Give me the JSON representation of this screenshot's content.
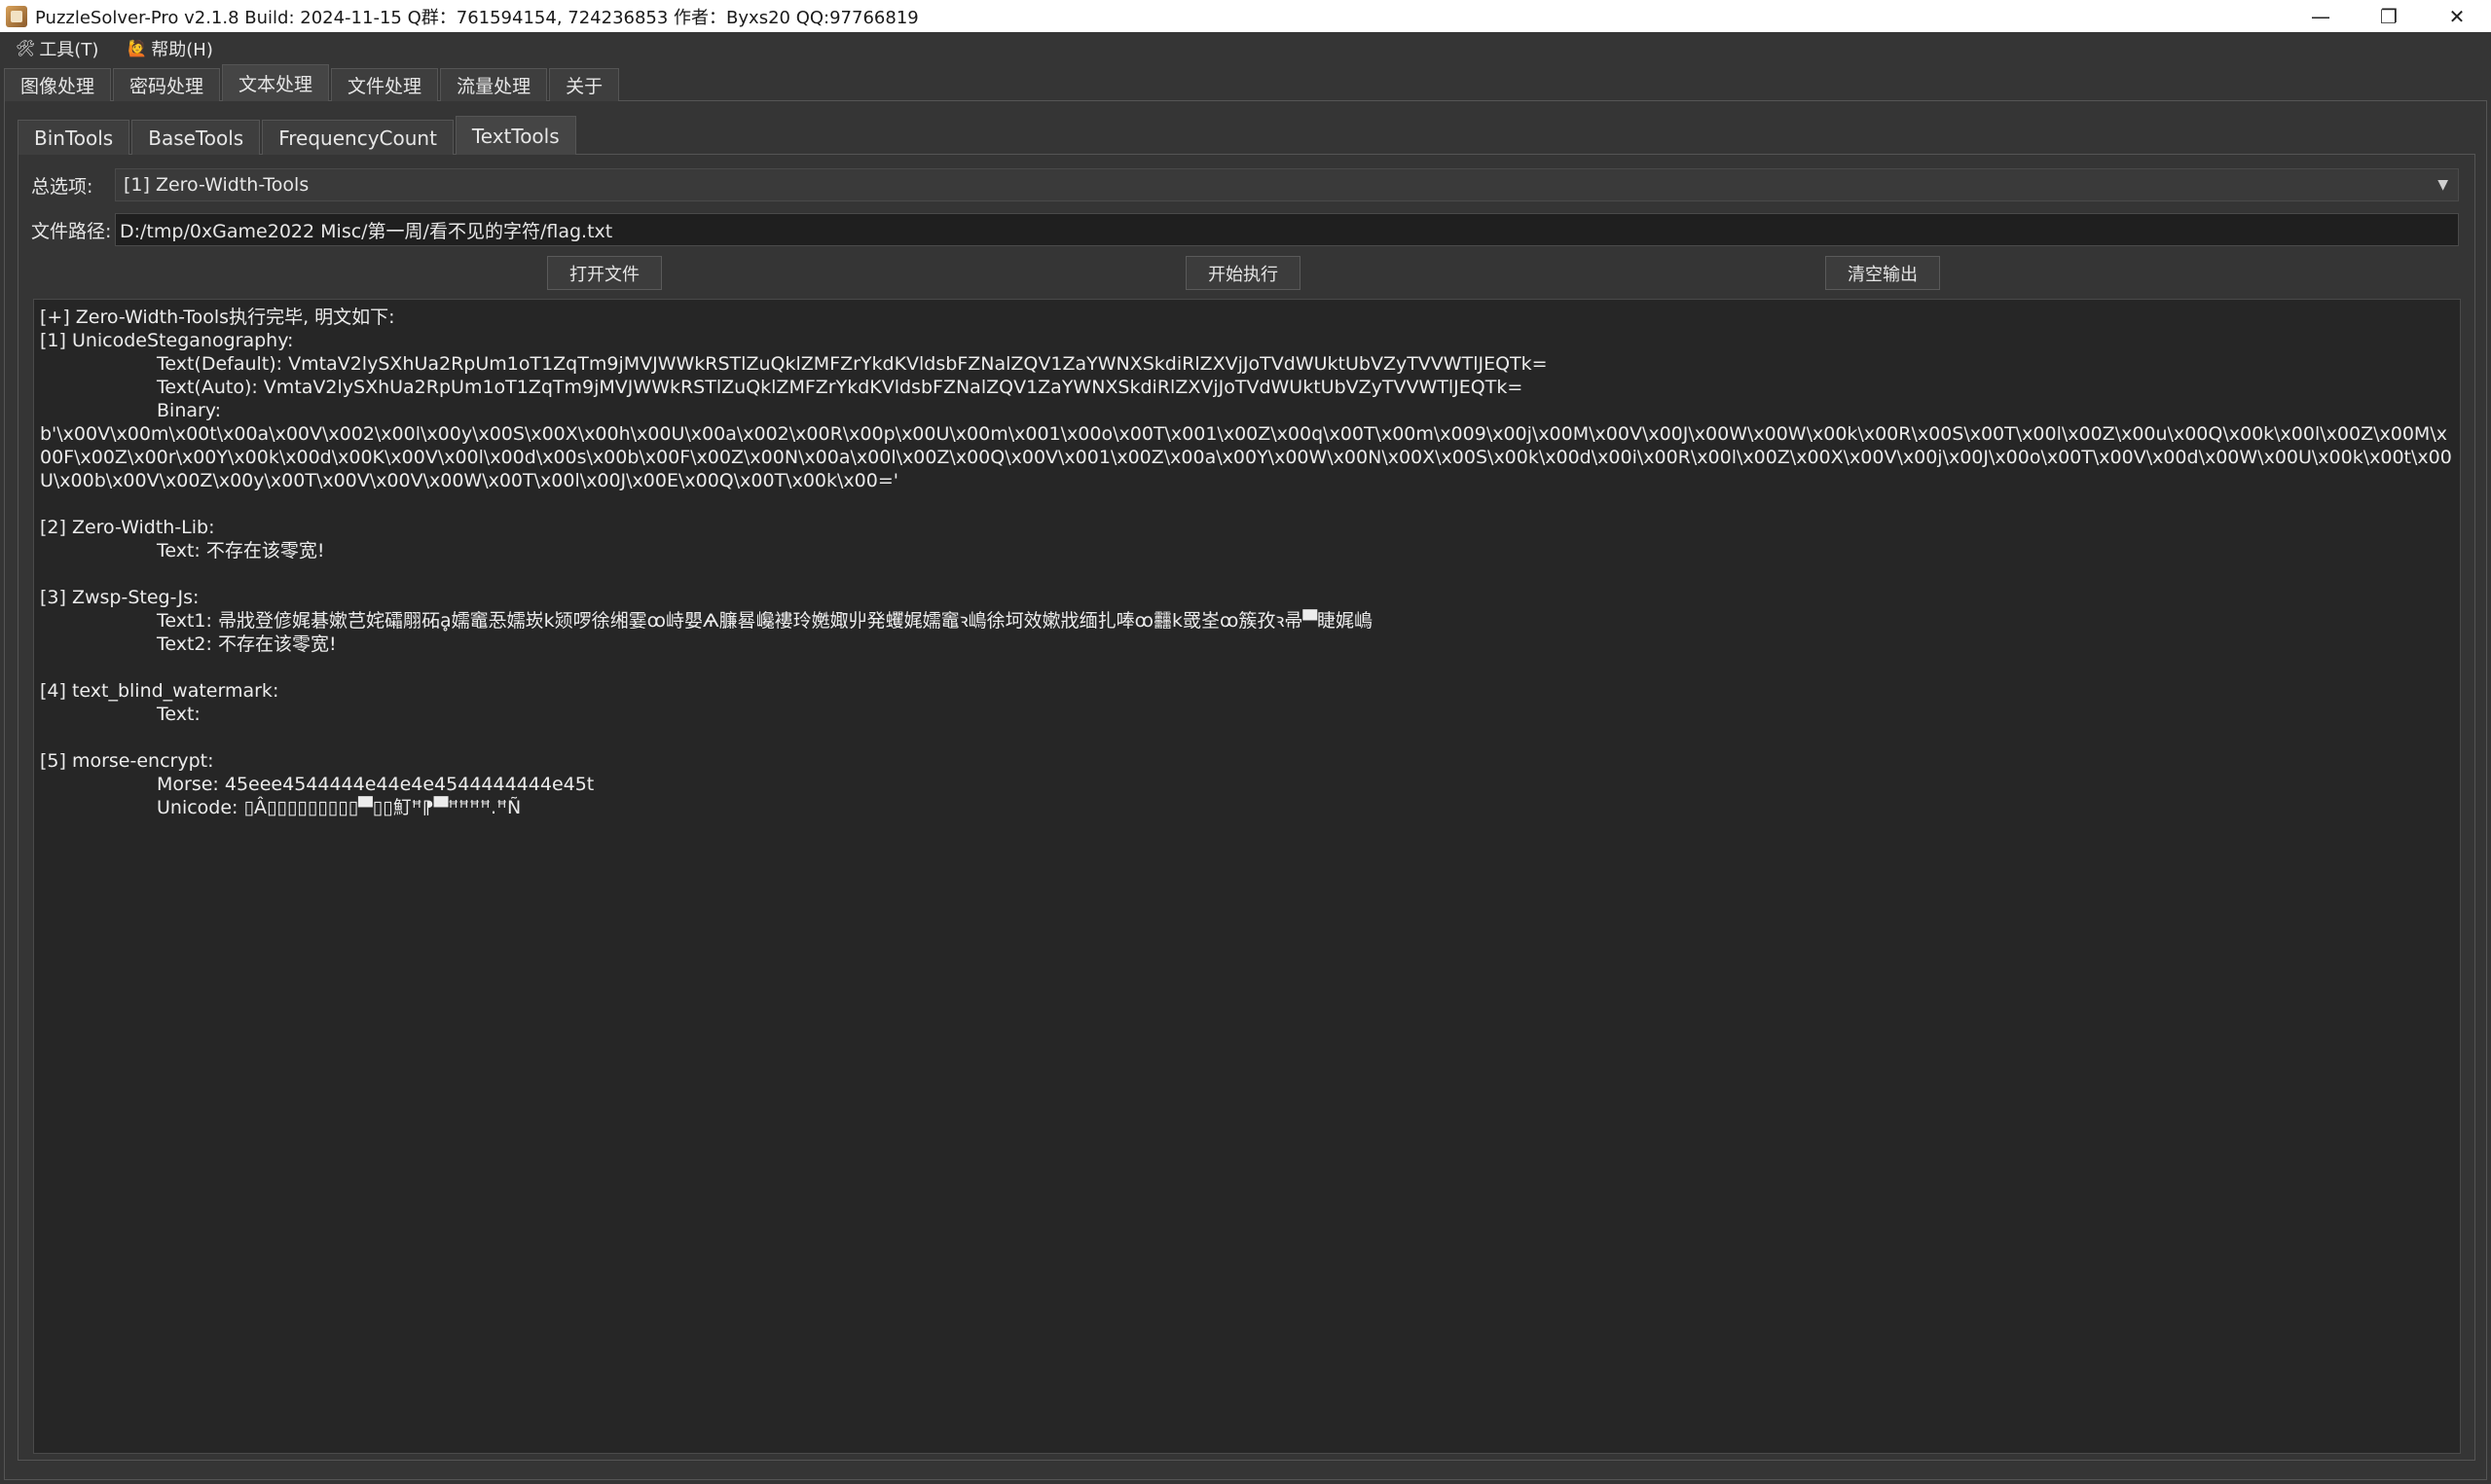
{
  "window": {
    "title": "PuzzleSolver-Pro v2.1.8  Build: 2024-11-15  Q群：761594154, 724236853  作者：Byxs20  QQ:97766819",
    "minimize": "—",
    "restore": "❐",
    "close": "✕"
  },
  "menu": [
    {
      "label": "工具(T)",
      "icon": "🛠"
    },
    {
      "label": "帮助(H)",
      "icon": "🙋"
    }
  ],
  "top_tabs": [
    "图像处理",
    "密码处理",
    "文本处理",
    "文件处理",
    "流量处理",
    "关于"
  ],
  "sub_tabs": [
    "BinTools",
    "BaseTools",
    "FrequencyCount",
    "TextTools"
  ],
  "options": {
    "label": "总选项:",
    "selected": "[1] Zero-Width-Tools"
  },
  "file": {
    "label": "文件路径:",
    "path": "D:/tmp/0xGame2022 Misc/第一周/看不见的字符/flag.txt"
  },
  "buttons": {
    "open": "打开文件",
    "run": "开始执行",
    "clear": "清空输出"
  },
  "output": {
    "l1": "[+] Zero-Width-Tools执行完毕, 明文如下:",
    "l2": "[1] UnicodeSteganography:",
    "l3": "Text(Default): VmtaV2lySXhUa2RpUm1oT1ZqTm9jMVJWWkRSTlZuQklZMFZrYkdKVldsbFZNalZQV1ZaYWNXSkdiRlZXVjJoTVdWUktUbVZyTVVWTlJEQTk=",
    "l4": "Text(Auto): VmtaV2lySXhUa2RpUm1oT1ZqTm9jMVJWWkRSTlZuQklZMFZrYkdKVldsbFZNalZQV1ZaYWNXSkdiRlZXVjJoTVdWUktUbVZyTVVWTlJEQTk=",
    "l5": "Binary:",
    "l6": "b'\\x00V\\x00m\\x00t\\x00a\\x00V\\x002\\x00l\\x00y\\x00S\\x00X\\x00h\\x00U\\x00a\\x002\\x00R\\x00p\\x00U\\x00m\\x001\\x00o\\x00T\\x001\\x00Z\\x00q\\x00T\\x00m\\x009\\x00j\\x00M\\x00V\\x00J\\x00W\\x00W\\x00k\\x00R\\x00S\\x00T\\x00l\\x00Z\\x00u\\x00Q\\x00k\\x00l\\x00Z\\x00M\\x00F\\x00Z\\x00r\\x00Y\\x00k\\x00d\\x00K\\x00V\\x00l\\x00d\\x00s\\x00b\\x00F\\x00Z\\x00N\\x00a\\x00l\\x00Z\\x00Q\\x00V\\x001\\x00Z\\x00a\\x00Y\\x00W\\x00N\\x00X\\x00S\\x00k\\x00d\\x00i\\x00R\\x00l\\x00Z\\x00X\\x00V\\x00j\\x00J\\x00o\\x00T\\x00V\\x00d\\x00W\\x00U\\x00k\\x00t\\x00U\\x00b\\x00V\\x00Z\\x00y\\x00T\\x00V\\x00V\\x00W\\x00T\\x00l\\x00J\\x00E\\x00Q\\x00T\\x00k\\x00='",
    "l7": "[2] Zero-Width-Lib:",
    "l8": "Text: 不存在该零宽!",
    "l9": "[3] Zwsp-Steg-Js:",
    "l10": "Text1: 帚戕登偐娓碁嫰芑姹礵翢砳ḁ嬬竈忢嬬崁k颎啰徐缃霎ꝏ峙嬰Ѧ臁晷巉褸玲嬎娵丱発蠼娓嬬竈ꝛ嶋徐坷效嫰戕缅扎唪ꝏ䨻k罭峑ꝏ簇孜ꝛ帚▀睫娓嶋",
    "l11": "Text2: 不存在该零宽!",
    "l12": "[4] text_blind_watermark:",
    "l13": "Text:",
    "l14": "[5] morse-encrypt:",
    "l15": "Morse: 45eee4544444e44e4e4544444444e45t",
    "l16": "Unicode: ▯Â▯▯▯▯▯▯▯▯▯▀▯▯䰳ꟸ⁋▀ꟸꟸꟸꟸ.ꟸÑ"
  }
}
